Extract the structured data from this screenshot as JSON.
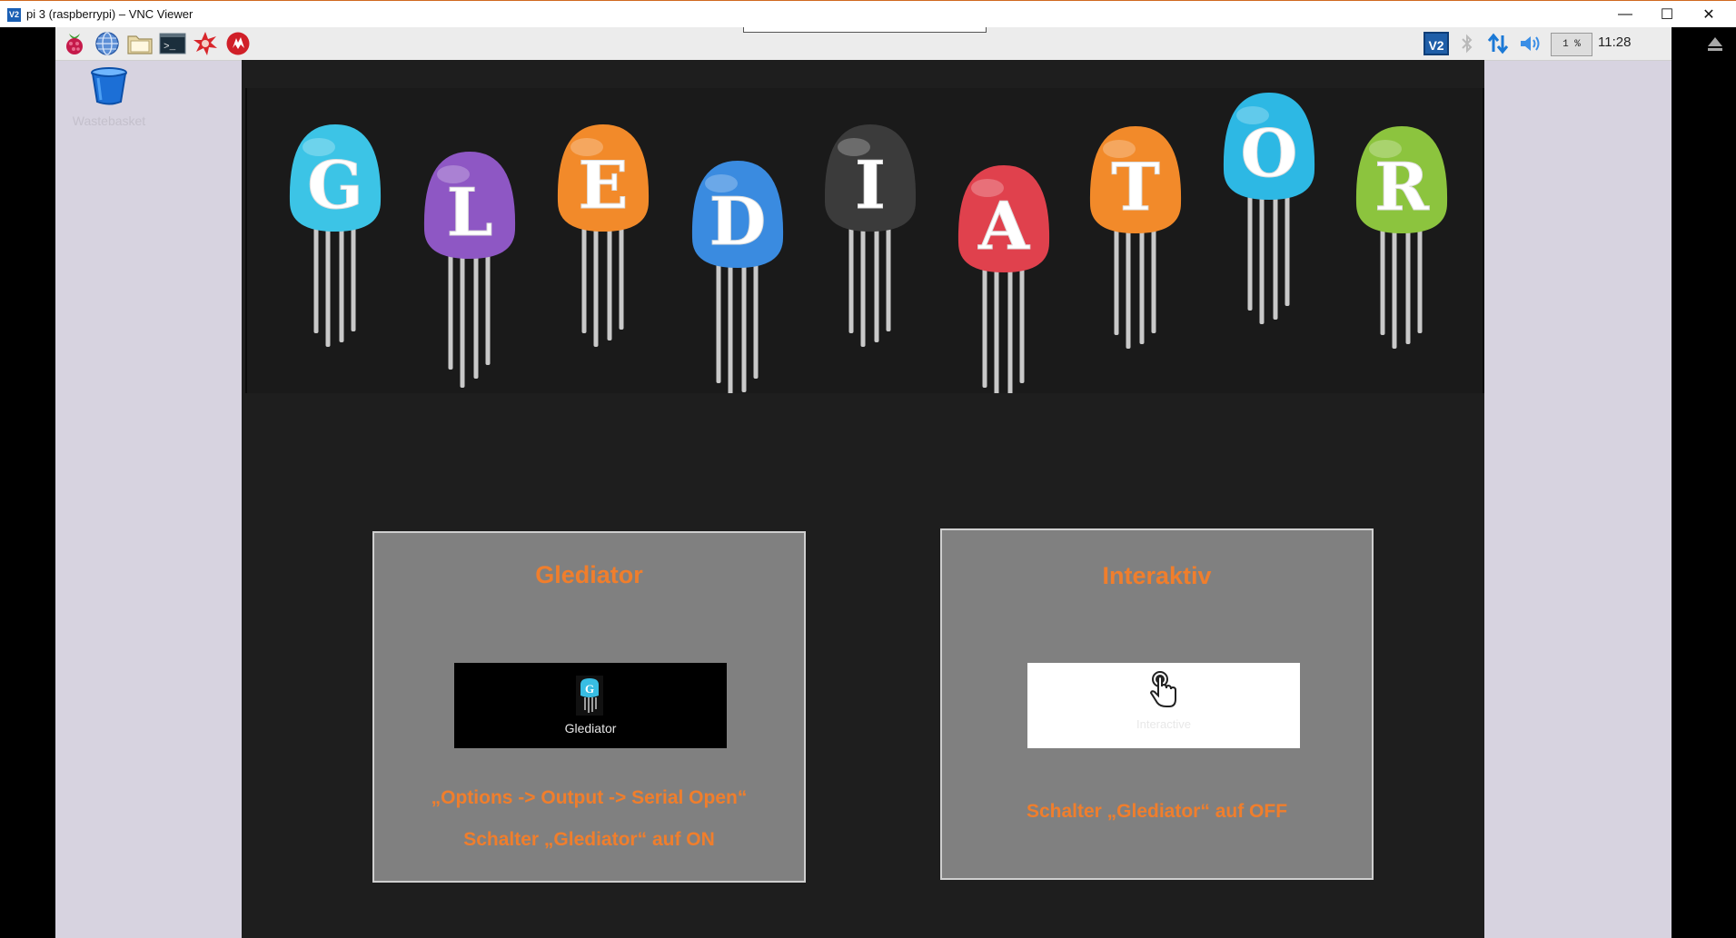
{
  "window": {
    "title": "pi 3 (raspberrypi) – VNC Viewer",
    "app_icon_label": "V2",
    "minimize_label": "—",
    "maximize_label": "☐",
    "close_label": "✕"
  },
  "panel": {
    "cpu_usage": "1 %",
    "clock": "11:28",
    "vnc_icon_label": "V2"
  },
  "desktop": {
    "wastebasket_label": "Wastebasket"
  },
  "banner": {
    "letters": [
      "G",
      "L",
      "E",
      "D",
      "I",
      "A",
      "T",
      "O",
      "R"
    ],
    "colors": [
      "#3cc4e6",
      "#8e57c4",
      "#f28a2a",
      "#3a8be0",
      "#3b3b3b",
      "#e0414d",
      "#f28a2a",
      "#2db8e4",
      "#8cc43e"
    ]
  },
  "gllediator_box": {
    "title": "Glediator",
    "app_button_label": "Glediator",
    "app_icon_letter": "G",
    "instruction_1": "„Options -> Output -> Serial Open“",
    "instruction_2": "Schalter „Glediator“ auf ON"
  },
  "interaktiv_box": {
    "title": "Interaktiv",
    "app_button_label": "Interactive",
    "instruction_1": "Schalter „Glediator“ auf OFF"
  }
}
